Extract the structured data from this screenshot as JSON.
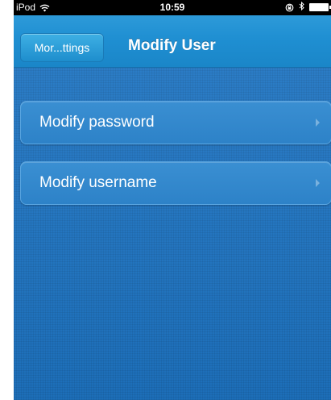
{
  "status_bar": {
    "carrier": "iPod",
    "time": "10:59"
  },
  "icons": {
    "wifi": "wifi-icon",
    "rotation_lock": "rotation-lock-icon",
    "bluetooth": "bluetooth-icon",
    "battery": "battery-icon",
    "chevron": "chevron-right-icon"
  },
  "nav": {
    "back_label": "Mor...ttings",
    "title": "Modify User"
  },
  "menu": {
    "items": [
      {
        "label": "Modify password"
      },
      {
        "label": "Modify username"
      }
    ]
  },
  "colors": {
    "nav_bar": "#1f8fd2",
    "background": "#1e74c2",
    "row": "#2d82c8",
    "text": "#ffffff"
  }
}
